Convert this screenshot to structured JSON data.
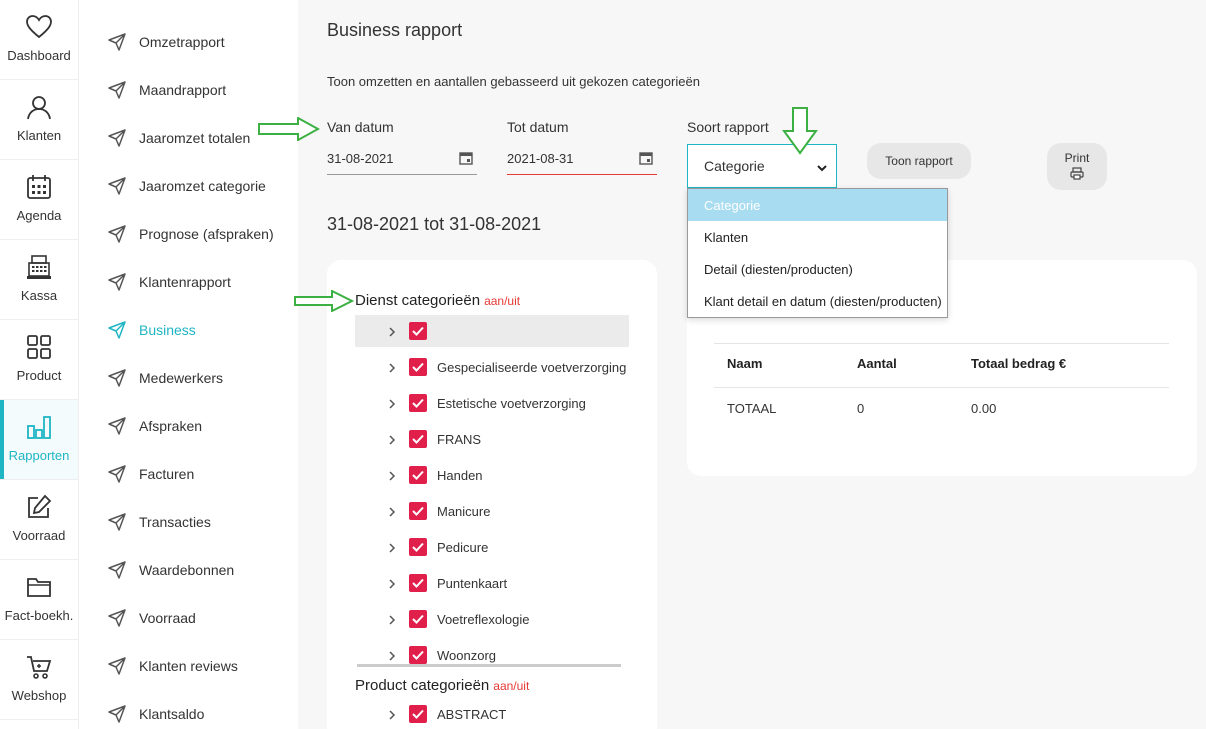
{
  "rail": [
    {
      "label": "Dashboard",
      "icon": "heart-icon"
    },
    {
      "label": "Klanten",
      "icon": "user-icon"
    },
    {
      "label": "Agenda",
      "icon": "calendar-icon"
    },
    {
      "label": "Kassa",
      "icon": "cash-register-icon"
    },
    {
      "label": "Product",
      "icon": "grid-icon"
    },
    {
      "label": "Rapporten",
      "icon": "bar-chart-icon",
      "active": true
    },
    {
      "label": "Voorraad",
      "icon": "edit-icon"
    },
    {
      "label": "Fact-boekh.",
      "icon": "folder-icon"
    },
    {
      "label": "Webshop",
      "icon": "cart-icon"
    }
  ],
  "subnav": [
    {
      "label": "Omzetrapport"
    },
    {
      "label": "Maandrapport"
    },
    {
      "label": "Jaaromzet totalen"
    },
    {
      "label": "Jaaromzet categorie"
    },
    {
      "label": "Prognose (afspraken)"
    },
    {
      "label": "Klantenrapport"
    },
    {
      "label": "Business",
      "active": true
    },
    {
      "label": "Medewerkers"
    },
    {
      "label": "Afspraken"
    },
    {
      "label": "Facturen"
    },
    {
      "label": "Transacties"
    },
    {
      "label": "Waardebonnen"
    },
    {
      "label": "Voorraad"
    },
    {
      "label": "Klanten reviews"
    },
    {
      "label": "Klantsaldo"
    }
  ],
  "page": {
    "title": "Business rapport",
    "description": "Toon omzetten en aantallen gebasseerd uit gekozen categorieën"
  },
  "filters": {
    "from_label": "Van datum",
    "from_value": "31-08-2021",
    "to_label": "Tot datum",
    "to_value": "2021-08-31",
    "type_label": "Soort rapport",
    "type_value": "Categorie",
    "type_options": [
      "Categorie",
      "Klanten",
      "Detail (diesten/producten)",
      "Klant detail en datum (diesten/producten)"
    ],
    "show_button": "Toon rapport",
    "print_button": "Print"
  },
  "range_title": "31-08-2021 tot 31-08-2021",
  "service_categories": {
    "title": "Dienst categorieën",
    "toggle": "aan/uit",
    "items": [
      "",
      "Gespecialiseerde voetverzorging",
      "Estetische voetverzorging",
      "FRANS",
      "Handen",
      "Manicure",
      "Pedicure",
      "Puntenkaart",
      "Voetreflexologie",
      "Woonzorg"
    ]
  },
  "product_categories": {
    "title": "Product categorieën",
    "toggle": "aan/uit",
    "items": [
      "ABSTRACT"
    ]
  },
  "table": {
    "headers": [
      "Naam",
      "Aantal",
      "Totaal bedrag €"
    ],
    "rows": [
      [
        "TOTAAL",
        "0",
        "0.00"
      ]
    ]
  },
  "colors": {
    "accent": "#1fb5c4",
    "checkbox": "#e0204a",
    "toggle_link": "#e53935",
    "annotation_arrow": "#3cb043"
  }
}
